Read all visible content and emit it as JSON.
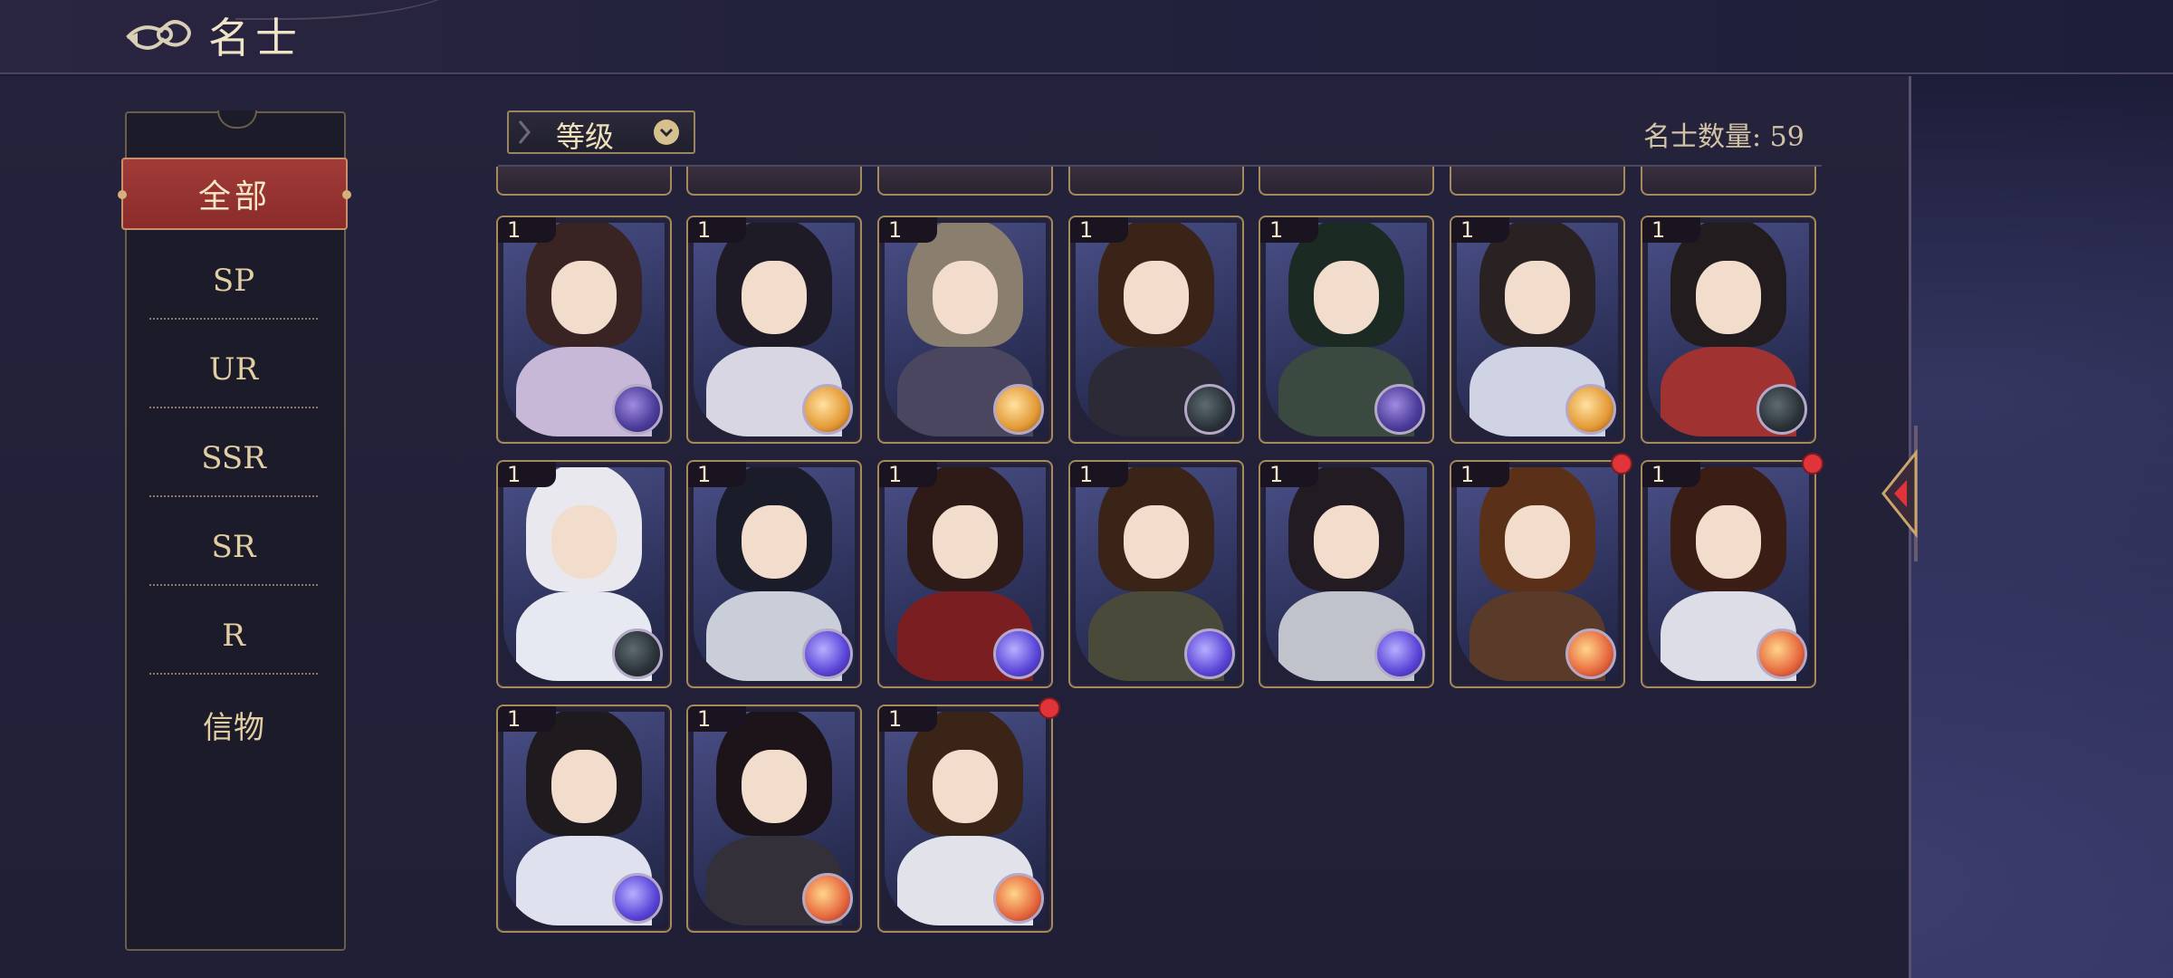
{
  "header": {
    "title": "名士"
  },
  "nav": {
    "active": "全部",
    "items": [
      "SP",
      "UR",
      "SSR",
      "SR",
      "R",
      "信物"
    ]
  },
  "sort": {
    "label": "等级"
  },
  "count": {
    "text": "名士数量: 59"
  },
  "colors": {
    "accent_red": "#a13b38",
    "gold": "#d6c08e",
    "notify": "#e0333a"
  },
  "cards": [
    {
      "level": "1",
      "orb": "purple",
      "hair": "#3a2323",
      "robe": "#c8b8d8",
      "notify": false
    },
    {
      "level": "1",
      "orb": "gold",
      "hair": "#1e1a26",
      "robe": "#d8d6e2",
      "notify": false
    },
    {
      "level": "1",
      "orb": "gold",
      "hair": "#8a7e6e",
      "robe": "#4a4660",
      "notify": false
    },
    {
      "level": "1",
      "orb": "dark",
      "hair": "#3a2418",
      "robe": "#2c2a36",
      "notify": false
    },
    {
      "level": "1",
      "orb": "purple",
      "hair": "#1c2a24",
      "robe": "#3b4a40",
      "notify": false
    },
    {
      "level": "1",
      "orb": "gold",
      "hair": "#2a2222",
      "robe": "#cfd3e4",
      "notify": false
    },
    {
      "level": "1",
      "orb": "dark",
      "hair": "#231c1e",
      "robe": "#a03232",
      "notify": false
    },
    {
      "level": "1",
      "orb": "dark",
      "hair": "#e8e8ee",
      "robe": "#e6e8f2",
      "notify": false
    },
    {
      "level": "1",
      "orb": "blue",
      "hair": "#1a1c2a",
      "robe": "#c9ced8",
      "notify": false
    },
    {
      "level": "1",
      "orb": "blue",
      "hair": "#2e1a16",
      "robe": "#7a1e22",
      "notify": false
    },
    {
      "level": "1",
      "orb": "blue",
      "hair": "#3a2418",
      "robe": "#4a4a3a",
      "notify": false
    },
    {
      "level": "1",
      "orb": "blue",
      "hair": "#221c22",
      "robe": "#c0c2cc",
      "notify": false
    },
    {
      "level": "1",
      "orb": "red",
      "hair": "#5a3018",
      "robe": "#5a3a28",
      "notify": true
    },
    {
      "level": "1",
      "orb": "red",
      "hair": "#3a1e16",
      "robe": "#dcdde6",
      "notify": true
    },
    {
      "level": "1",
      "orb": "blue",
      "hair": "#1e1a1e",
      "robe": "#dfe2ee",
      "notify": false
    },
    {
      "level": "1",
      "orb": "red",
      "hair": "#1c1418",
      "robe": "#34303a",
      "notify": false
    },
    {
      "level": "1",
      "orb": "red",
      "hair": "#3a2418",
      "robe": "#e2e3ea",
      "notify": true
    }
  ]
}
